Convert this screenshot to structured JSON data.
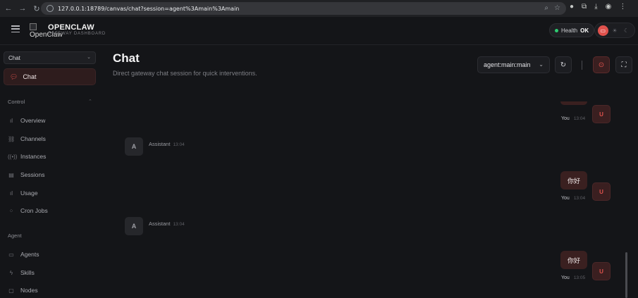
{
  "browser": {
    "url": "127.0.0.1:18789/canvas/chat?session=agent%3Amain%3Amain"
  },
  "header": {
    "logo_alt": "OpenClaw",
    "brand_name": "OPENCLAW",
    "brand_sub": "GATEWAY DASHBOARD",
    "health_label": "Health",
    "health_value": "OK"
  },
  "sidebar": {
    "selector_value": "Chat",
    "active_item": "Chat",
    "sections": [
      {
        "label": "Control",
        "items": [
          "Overview",
          "Channels",
          "Instances",
          "Sessions",
          "Usage",
          "Cron Jobs"
        ]
      },
      {
        "label": "Agent",
        "items": [
          "Agents",
          "Skills",
          "Nodes"
        ]
      }
    ]
  },
  "main": {
    "title": "Chat",
    "subtitle": "Direct gateway chat session for quick interventions.",
    "session_value": "agent:main:main"
  },
  "chat": {
    "messages": [
      {
        "role": "user",
        "sender": "You",
        "time": "13:04",
        "text": ""
      },
      {
        "role": "assistant",
        "sender": "Assistant",
        "avatar": "A",
        "time": "13:04"
      },
      {
        "role": "user",
        "sender": "You",
        "avatar": "U",
        "time": "13:04",
        "text": "你好"
      },
      {
        "role": "assistant",
        "sender": "Assistant",
        "avatar": "A",
        "time": "13:04"
      },
      {
        "role": "user",
        "sender": "You",
        "avatar": "U",
        "time": "13:05",
        "text": "你好"
      }
    ],
    "user_avatar": "U"
  },
  "colors": {
    "accent": "#e0524d",
    "health_ok": "#2ecc71",
    "background": "#141518",
    "user_bubble": "#3a2020"
  }
}
